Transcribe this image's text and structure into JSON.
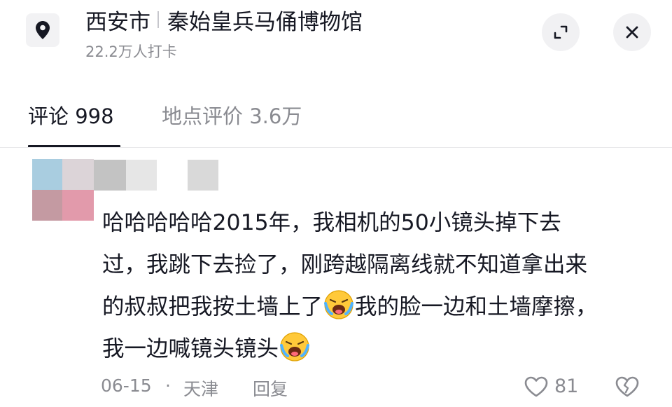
{
  "header": {
    "location_icon": "map-pin-icon",
    "city": "西安市",
    "place": "秦始皇兵马俑博物馆",
    "checkins": "22.2万人打卡",
    "expand_icon": "expand-icon",
    "close_icon": "close-icon"
  },
  "tabs": [
    {
      "label": "评论 998",
      "active": true
    },
    {
      "label": "地点评价 3.6万",
      "active": false
    }
  ],
  "comment": {
    "avatar": "blurred-avatar",
    "lines": [
      "哈哈哈哈哈2015年，我相机的50小镜头掉下去",
      "过，我跳下去捡了，刚跨越隔离线就不知道拿出来"
    ],
    "line3_a": "的叔叔把我按土墙上了",
    "line3_b": "我的脸一边和土墙摩擦，",
    "line4": "我一边喊镜头镜头",
    "emoji": "laugh-cry-emoji",
    "date": "06-15",
    "separator": "·",
    "location": "天津",
    "reply_label": "回复",
    "like_count": "81",
    "like_icon": "heart-icon",
    "dislike_icon": "broken-heart-icon"
  },
  "colors": {
    "primary_text": "#161823",
    "secondary_text": "#8a8b91",
    "button_bg": "#f1f1f3"
  }
}
